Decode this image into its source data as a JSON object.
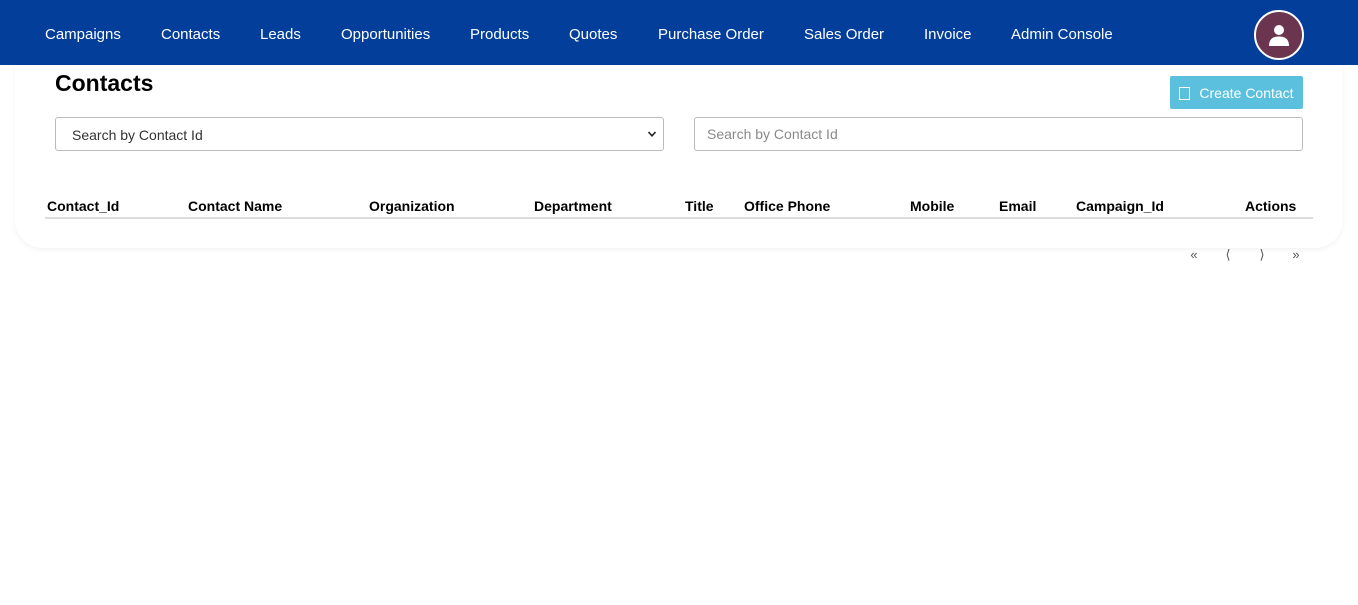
{
  "nav": {
    "items": [
      {
        "label": "Campaigns"
      },
      {
        "label": "Contacts"
      },
      {
        "label": "Leads"
      },
      {
        "label": "Opportunities"
      },
      {
        "label": "Products"
      },
      {
        "label": "Quotes"
      },
      {
        "label": "Purchase Order"
      },
      {
        "label": "Sales Order"
      },
      {
        "label": "Invoice"
      },
      {
        "label": "Admin Console"
      }
    ],
    "avatar_icon": "user-icon"
  },
  "page": {
    "title": "Contacts",
    "create_button_label": "Create Contact",
    "create_button_icon": "square-icon"
  },
  "filters": {
    "select_value": "Search by Contact Id",
    "search_placeholder": "Search by Contact Id"
  },
  "table": {
    "columns": [
      "Contact_Id",
      "Contact Name",
      "Organization",
      "Department",
      "Title",
      "Office Phone",
      "Mobile",
      "Email",
      "Campaign_Id",
      "Actions"
    ],
    "rows": []
  },
  "pagination": {
    "first": "«",
    "prev": "⟨",
    "next": "⟩",
    "last": "»"
  },
  "colors": {
    "navbar": "#023e9a",
    "avatar": "#6b3550",
    "create_button": "#5bc0de"
  }
}
